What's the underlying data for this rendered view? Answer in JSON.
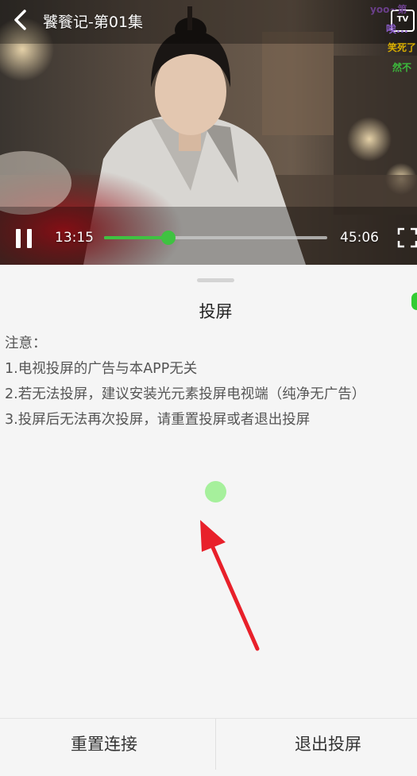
{
  "video": {
    "title": "饕餮记-第01集",
    "tv_label": "TV",
    "danmaku": [
      "yoo~第",
      "唉...",
      "笑死了",
      "然不"
    ],
    "current_time": "13:15",
    "total_time": "45:06",
    "progress": 0.29
  },
  "sheet": {
    "title": "投屏",
    "notes": [
      "注意：",
      "1.电视投屏的广告与本APP无关",
      "2.若无法投屏，建议安装光元素投屏电视端（纯净无广告）",
      "3.投屏后无法再次投屏，请重置投屏或者退出投屏"
    ],
    "reset_button": "重置连接",
    "exit_button": "退出投屏"
  },
  "colors": {
    "accent": "#3fc241",
    "touch_indicator": "#a6f09c",
    "arrow": "#e8202a",
    "background": "#f5f5f5"
  }
}
